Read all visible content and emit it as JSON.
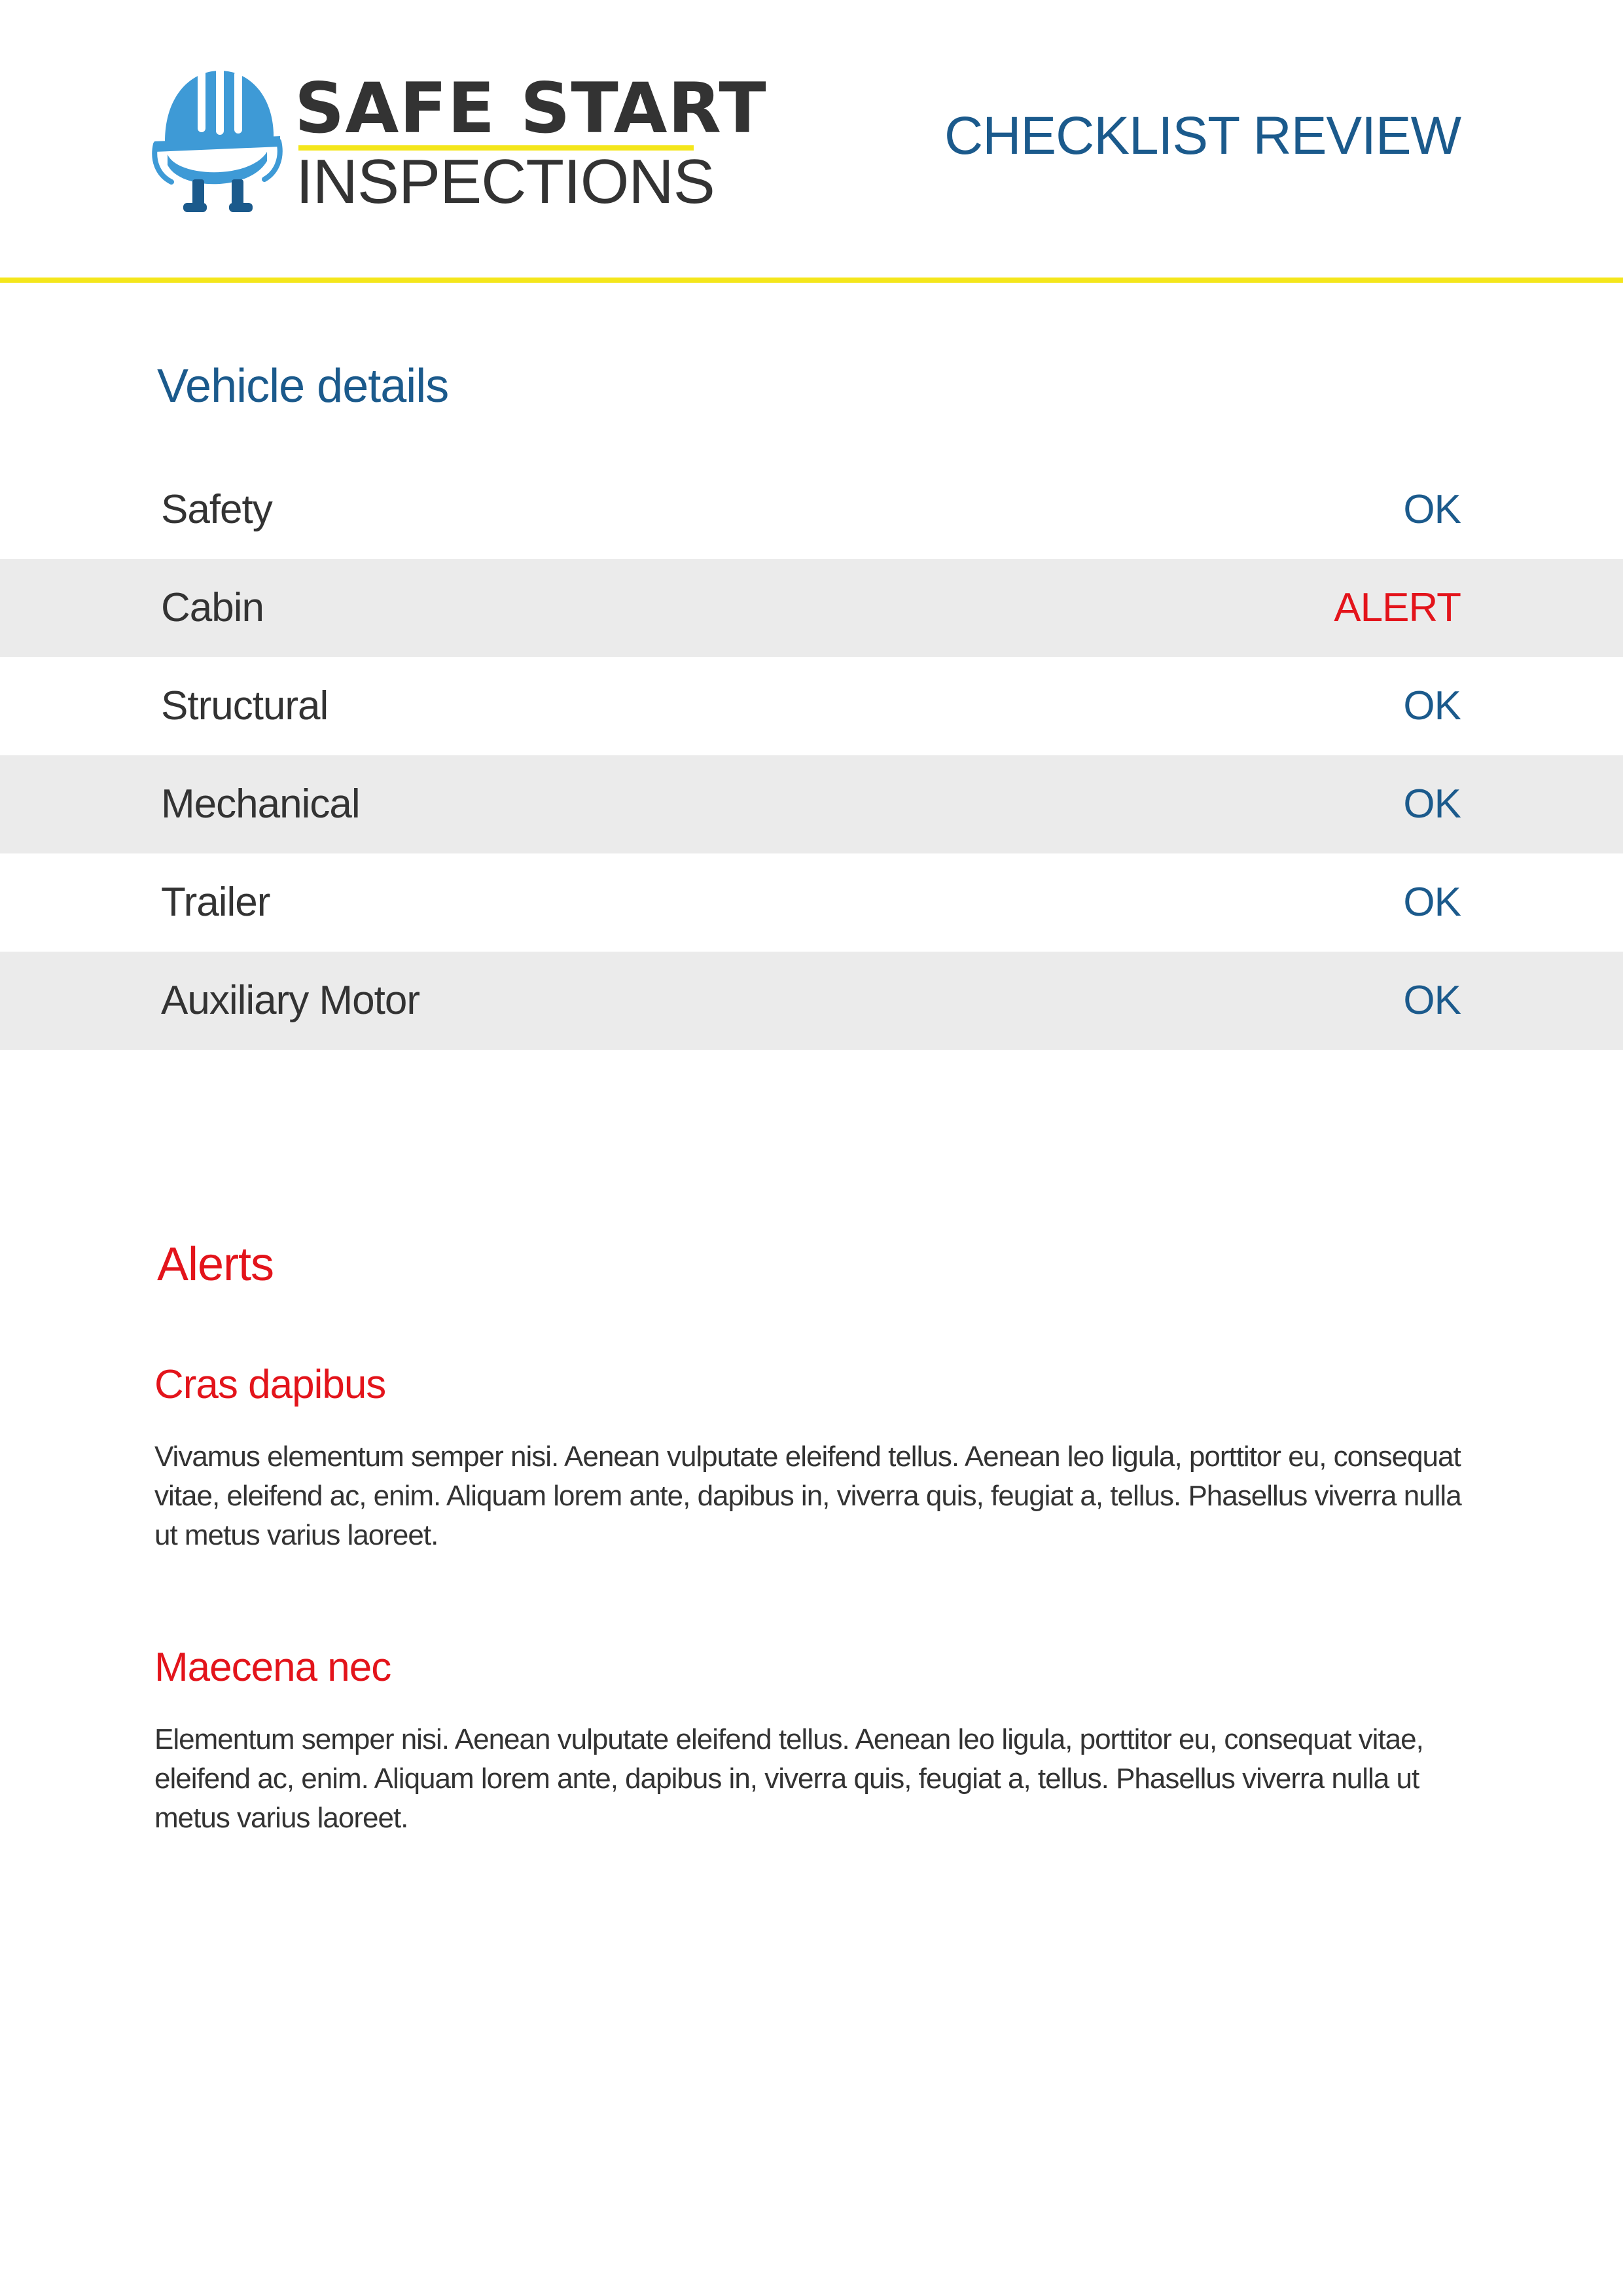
{
  "header": {
    "logo": {
      "line1": "SAFE START",
      "line2": "INSPECTIONS",
      "icon": "hard-hat-mascot-icon"
    },
    "title": "CHECKLIST REVIEW"
  },
  "colors": {
    "accent_yellow": "#f4e61b",
    "brand_blue": "#1b5a8c",
    "logo_blue": "#3e9ad6",
    "alert_red": "#e3141b",
    "row_shade": "#ebebeb",
    "text_dark": "#333333"
  },
  "vehicle": {
    "title": "Vehicle details",
    "items": [
      {
        "label": "Safety",
        "status": "OK"
      },
      {
        "label": "Cabin",
        "status": "ALERT"
      },
      {
        "label": "Structural",
        "status": "OK"
      },
      {
        "label": "Mechanical",
        "status": "OK"
      },
      {
        "label": "Trailer",
        "status": "OK"
      },
      {
        "label": "Auxiliary Motor",
        "status": "OK"
      }
    ]
  },
  "alerts": {
    "title": "Alerts",
    "items": [
      {
        "heading": "Cras dapibus",
        "body": "Vivamus elementum semper nisi. Aenean vulputate eleifend tellus. Aenean leo ligula, porttitor eu, consequat vitae, eleifend ac, enim. Aliquam lorem ante, dapibus in, viverra quis, feugiat a, tellus. Phasellus viverra nulla ut metus varius laoreet."
      },
      {
        "heading": "Maecena nec",
        "body": "Elementum semper nisi. Aenean vulputate eleifend tellus. Aenean leo ligula, porttitor eu, consequat vitae, eleifend ac, enim. Aliquam lorem ante, dapibus in, viverra quis, feugiat a, tellus. Phasellus viverra nulla ut metus varius laoreet."
      }
    ]
  }
}
